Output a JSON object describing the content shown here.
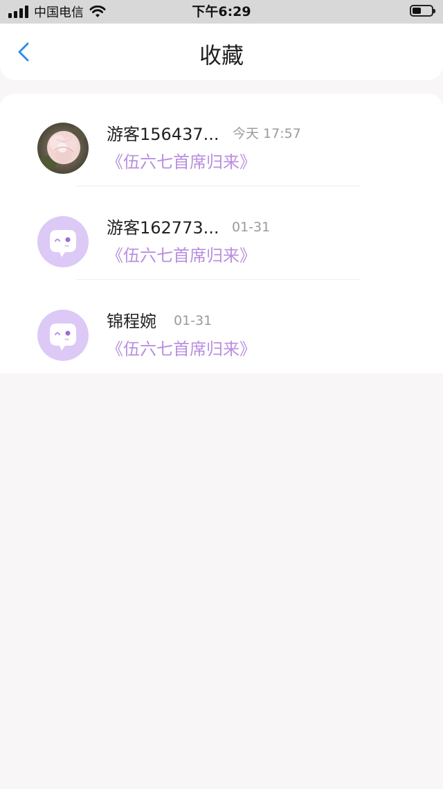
{
  "status_bar": {
    "carrier": "中国电信",
    "time": "下午6:29"
  },
  "nav": {
    "title": "收藏"
  },
  "items": [
    {
      "name": "游客156437...",
      "time": "今天 17:57",
      "link": "《伍六七首席归来》",
      "avatar": "flower-photo"
    },
    {
      "name": "游客162773...",
      "time": "01-31",
      "link": "《伍六七首席归来》",
      "avatar": "default-avatar-icon"
    },
    {
      "name": "锦程婉",
      "time": "01-31",
      "link": "《伍六七首席归来》",
      "avatar": "default-avatar-icon"
    }
  ],
  "colors": {
    "accent": "#2e8fe8",
    "link": "#b88fe0",
    "avatar_bg": "#dcc9f6",
    "page_bg": "#f8f6f7"
  }
}
